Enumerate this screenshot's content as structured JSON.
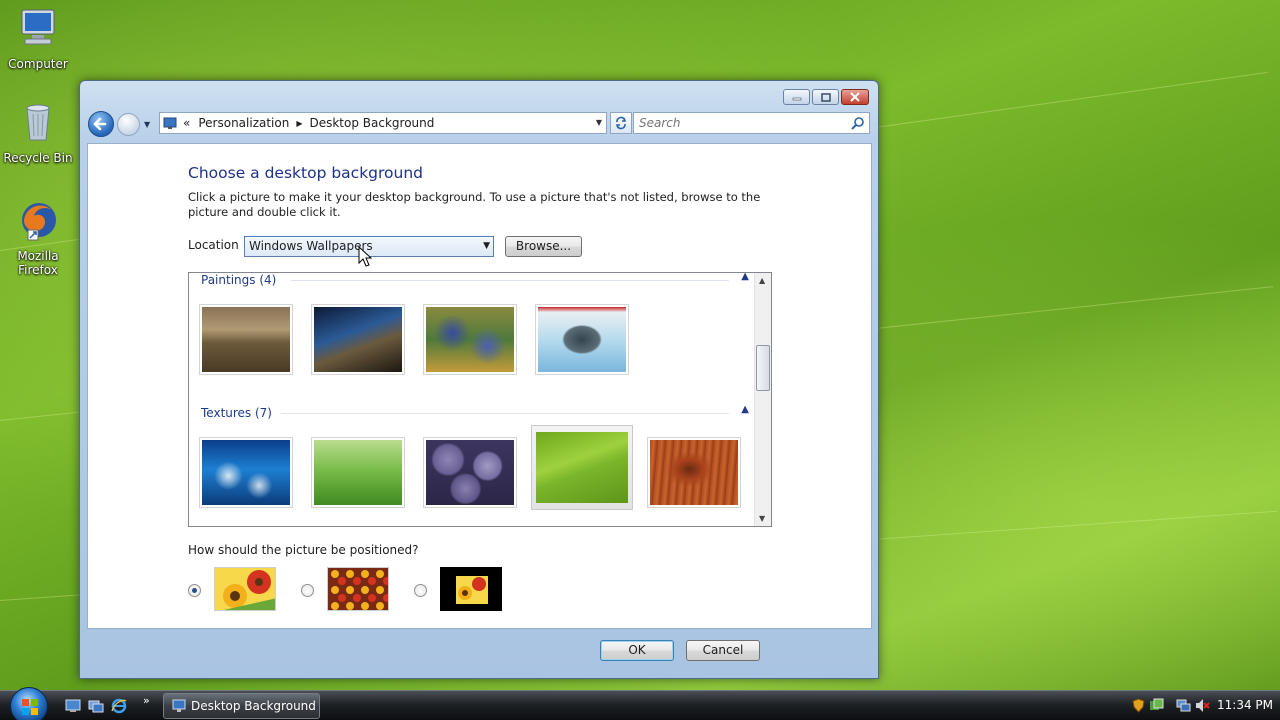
{
  "desktop": {
    "icons": [
      {
        "label": "Computer"
      },
      {
        "label": "Recycle Bin"
      },
      {
        "label": "Mozilla Firefox",
        "line1": "Mozilla",
        "line2": "Firefox"
      }
    ]
  },
  "window": {
    "address": {
      "chevron": "«",
      "crumbs": [
        "Personalization",
        "Desktop Background"
      ],
      "separator": "▶"
    },
    "search": {
      "placeholder": "Search"
    },
    "heading": "Choose a desktop background",
    "description": "Click a picture to make it your desktop background. To use a picture that's not listed, browse to the picture and double click it.",
    "location": {
      "label": "Location",
      "value": "Windows Wallpapers",
      "browse_label": "Browse..."
    },
    "gallery": {
      "groups": [
        {
          "title": "Paintings (4)",
          "thumbs": [
            "painting-park",
            "painting-bridge",
            "painting-irises",
            "painting-koi"
          ]
        },
        {
          "title": "Textures (7)",
          "thumbs": [
            "texture-fish",
            "texture-grass",
            "texture-stones",
            "texture-leaf",
            "texture-wood"
          ],
          "selected_index": 3
        }
      ]
    },
    "position": {
      "question": "How should the picture be positioned?",
      "options": [
        "fit-to-screen",
        "tile",
        "center"
      ],
      "selected_index": 0
    },
    "ok_label": "OK",
    "cancel_label": "Cancel"
  },
  "taskbar": {
    "task_label": "Desktop Background",
    "clock": "11:34 PM"
  },
  "colors": {
    "heading": "#1e3287",
    "group_header": "#1e3b8a",
    "taskbar": "#1f2226"
  }
}
